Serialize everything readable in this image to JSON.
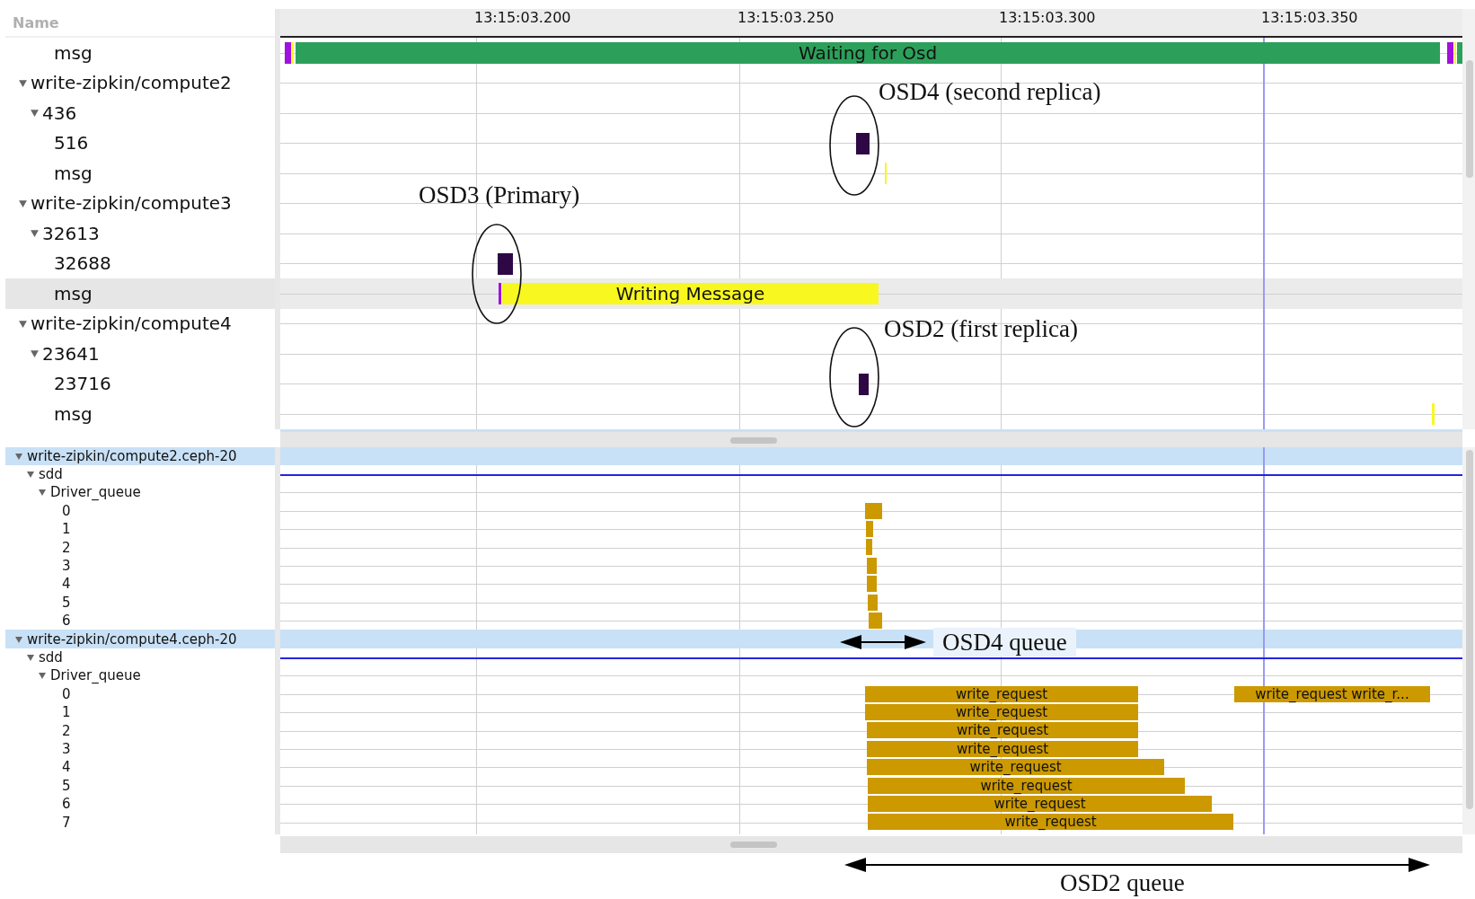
{
  "name_header": "Name",
  "time_axis": {
    "ticks": [
      "13:15:03.200",
      "13:15:03.250",
      "13:15:03.300",
      "13:15:03.350"
    ]
  },
  "upper_tree": [
    {
      "children": [
        {
          "children": [
            {
              "label": "msg",
              "selected": false,
              "events": [
                {
                  "color": "#a010e0"
                },
                {
                  "color": "#f8f820"
                },
                {
                  "label": "Waiting for Osd",
                  "color": "#2ca05a"
                },
                {
                  "color": "#a010e0"
                },
                {
                  "color": "#f8f820"
                },
                {
                  "color": "#2ca05a"
                }
              ]
            }
          ]
        }
      ]
    },
    {
      "label": "write-zipkin/compute2",
      "expanded": true,
      "selected": false,
      "children": [
        {
          "label": "436",
          "expanded": true,
          "selected": false,
          "children": [
            {
              "label": "516",
              "selected": false,
              "events": [
                {
                  "color": "#2e0845"
                }
              ]
            },
            {
              "label": "msg",
              "selected": false,
              "events": [
                {
                  "color": "#f8f820"
                }
              ]
            }
          ]
        }
      ]
    },
    {
      "label": "write-zipkin/compute3",
      "expanded": true,
      "selected": false,
      "children": [
        {
          "label": "32613",
          "expanded": true,
          "selected": false,
          "children": [
            {
              "label": "32688",
              "selected": false,
              "events": [
                {
                  "color": "#2e0845"
                }
              ]
            },
            {
              "label": "msg",
              "selected": true,
              "events": [
                {
                  "color": "#a010e0"
                },
                {
                  "label": "Writing Message",
                  "color": "#f8f820"
                }
              ]
            }
          ]
        }
      ]
    },
    {
      "label": "write-zipkin/compute4",
      "expanded": true,
      "selected": false,
      "children": [
        {
          "label": "23641",
          "expanded": true,
          "selected": false,
          "children": [
            {
              "label": "23716",
              "selected": false,
              "events": [
                {
                  "color": "#2e0845"
                }
              ]
            },
            {
              "label": "msg",
              "selected": false,
              "events": [
                {
                  "color": "#f8f820"
                }
              ]
            }
          ]
        }
      ]
    }
  ],
  "lower_tree": [
    {
      "label": "write-zipkin/compute2.ceph-20",
      "expanded": true,
      "selected": false,
      "children": [
        {
          "label": "sdd",
          "expanded": true,
          "selected": false,
          "children": [
            {
              "label": "Driver_queue",
              "expanded": true,
              "selected": false,
              "children": [
                {
                  "label": "0",
                  "selected": false,
                  "events": [
                    {
                      "color": "#cc9900"
                    }
                  ]
                },
                {
                  "label": "1",
                  "selected": false,
                  "events": [
                    {
                      "color": "#cc9900"
                    }
                  ]
                },
                {
                  "label": "2",
                  "selected": false,
                  "events": [
                    {
                      "color": "#cc9900"
                    }
                  ]
                },
                {
                  "label": "3",
                  "selected": false,
                  "events": [
                    {
                      "color": "#cc9900"
                    }
                  ]
                },
                {
                  "label": "4",
                  "selected": false,
                  "events": [
                    {
                      "color": "#cc9900"
                    }
                  ]
                },
                {
                  "label": "5",
                  "selected": false,
                  "events": [
                    {
                      "color": "#cc9900"
                    }
                  ]
                },
                {
                  "label": "6",
                  "selected": false,
                  "events": [
                    {
                      "color": "#cc9900"
                    }
                  ]
                }
              ]
            }
          ]
        }
      ]
    },
    {
      "label": "write-zipkin/compute4.ceph-20",
      "expanded": true,
      "selected": false,
      "children": [
        {
          "label": "sdd",
          "expanded": true,
          "selected": false,
          "children": [
            {
              "label": "Driver_queue",
              "expanded": true,
              "selected": false,
              "children": [
                {
                  "label": "0",
                  "selected": false,
                  "events": [
                    {
                      "label": "write_request",
                      "color": "#cc9900"
                    },
                    {
                      "label": "write_request  write_r...",
                      "color": "#cc9900"
                    }
                  ]
                },
                {
                  "label": "1",
                  "selected": false,
                  "events": [
                    {
                      "label": "write_request",
                      "color": "#cc9900"
                    }
                  ]
                },
                {
                  "label": "2",
                  "selected": false,
                  "events": [
                    {
                      "label": "write_request",
                      "color": "#cc9900"
                    }
                  ]
                },
                {
                  "label": "3",
                  "selected": false,
                  "events": [
                    {
                      "label": "write_request",
                      "color": "#cc9900"
                    }
                  ]
                },
                {
                  "label": "4",
                  "selected": false,
                  "events": [
                    {
                      "label": "write_request",
                      "color": "#cc9900"
                    }
                  ]
                },
                {
                  "label": "5",
                  "selected": false,
                  "events": [
                    {
                      "label": "write_request",
                      "color": "#cc9900"
                    }
                  ]
                },
                {
                  "label": "6",
                  "selected": false,
                  "events": [
                    {
                      "label": "write_request",
                      "color": "#cc9900"
                    }
                  ]
                },
                {
                  "label": "7",
                  "selected": false,
                  "events": [
                    {
                      "label": "write_request",
                      "color": "#cc9900"
                    }
                  ]
                }
              ]
            }
          ]
        }
      ]
    }
  ],
  "annotations": [
    {
      "kind": "ellipse",
      "text": "OSD4 (second replica)"
    },
    {
      "kind": "ellipse",
      "text": "OSD3 (Primary)"
    },
    {
      "kind": "ellipse",
      "text": "OSD2 (first replica)"
    },
    {
      "kind": "arrow",
      "text": "OSD4 queue"
    },
    {
      "kind": "arrow",
      "text": "OSD2 queue"
    }
  ]
}
